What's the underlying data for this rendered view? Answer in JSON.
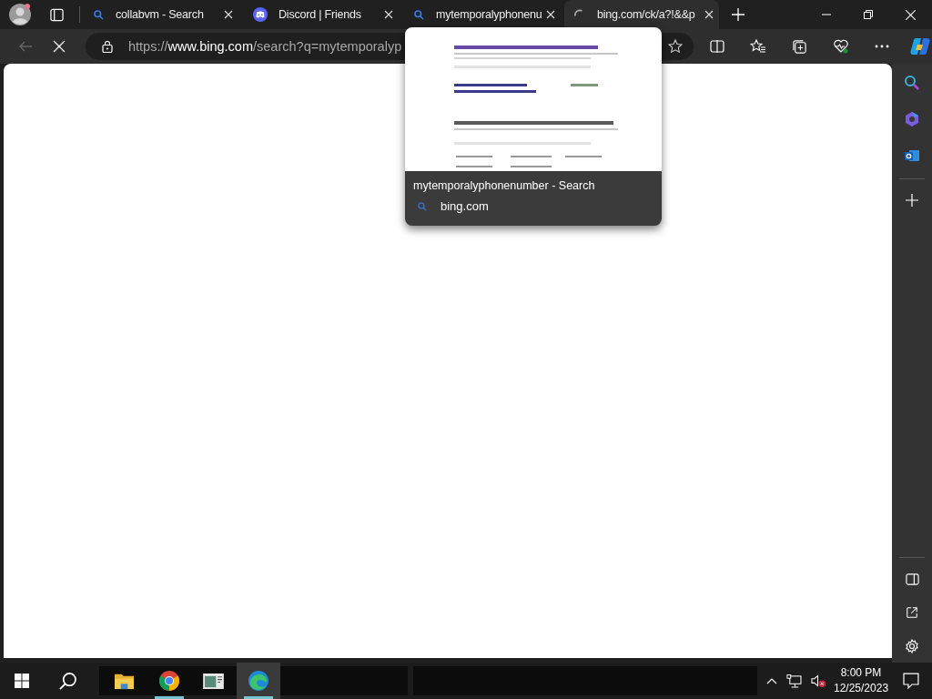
{
  "tabs": [
    {
      "title": "collabvm - Search",
      "kind": "search",
      "selected": false
    },
    {
      "title": "Discord | Friends",
      "kind": "discord",
      "selected": false
    },
    {
      "title": "mytemporalyphonenu",
      "kind": "search",
      "selected": false
    },
    {
      "title": "bing.com/ck/a?!&&p",
      "kind": "loading",
      "selected": true
    }
  ],
  "toolbar": {
    "back_disabled": true,
    "loading": true,
    "url": {
      "scheme": "https://",
      "host": "www.bing.com",
      "path": "/search?q=mytemporalyp"
    }
  },
  "hover_card": {
    "title": "mytemporalyphonenumber - Search",
    "site": "bing.com"
  },
  "taskbar": {
    "apps": [
      {
        "kind": "files",
        "running": false,
        "selected": false
      },
      {
        "kind": "chrome",
        "running": true,
        "selected": false
      },
      {
        "kind": "viewer",
        "running": false,
        "selected": false
      },
      {
        "kind": "edge",
        "running": true,
        "selected": true
      }
    ],
    "tray": {
      "volume_muted": true,
      "time": "8:00 PM",
      "date": "12/25/2023"
    }
  }
}
